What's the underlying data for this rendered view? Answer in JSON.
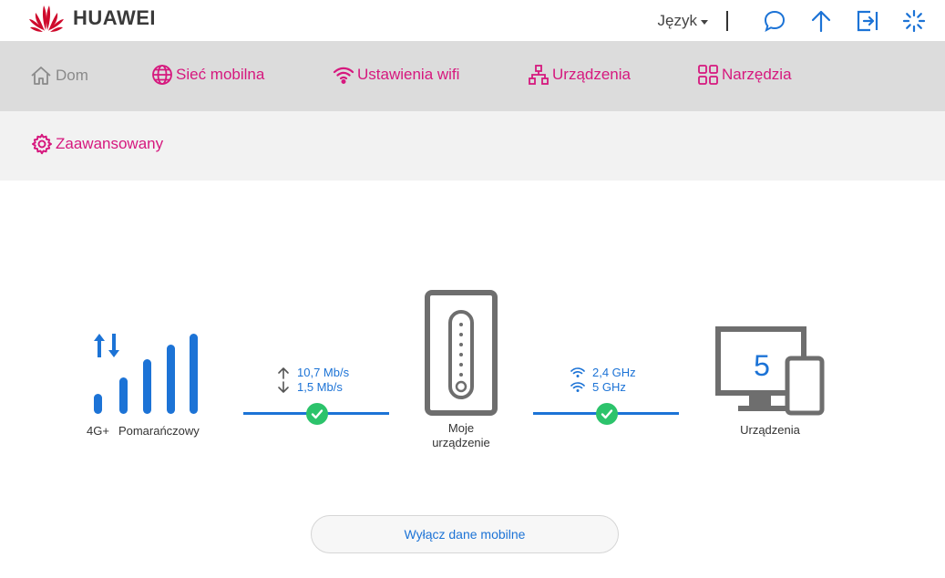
{
  "brand": {
    "name": "HUAWEI",
    "color": "#cf0a2c"
  },
  "header": {
    "language_label": "Język"
  },
  "nav": {
    "primary": [
      {
        "label": "Dom",
        "icon": "home-icon"
      },
      {
        "label": "Sieć mobilna",
        "icon": "globe-icon"
      },
      {
        "label": "Ustawienia wifi",
        "icon": "wifi-icon"
      },
      {
        "label": "Urządzenia",
        "icon": "network-icon"
      },
      {
        "label": "Narzędzia",
        "icon": "tools-grid-icon"
      }
    ],
    "secondary": [
      {
        "label": "Zaawansowany",
        "icon": "gear-icon"
      }
    ]
  },
  "status": {
    "network_type": "4G+",
    "operator": "Pomarańczowy",
    "upload_rate": "10,7 Mb/s",
    "download_rate": "1,5 Mb/s",
    "device_label_line1": "Moje",
    "device_label_line2": "urządzenie",
    "wifi_band_1": "2,4 GHz",
    "wifi_band_2": "5 GHz",
    "devices_count": "5",
    "devices_label": "Urządzenia"
  },
  "actions": {
    "disable_mobile_data": "Wyłącz dane mobilne"
  },
  "colors": {
    "accent": "#d6187e",
    "blue": "#1c73d6",
    "ok": "#2cc36b",
    "nav_bg": "#dcdcdc",
    "nav2_bg": "#f2f2f2"
  }
}
